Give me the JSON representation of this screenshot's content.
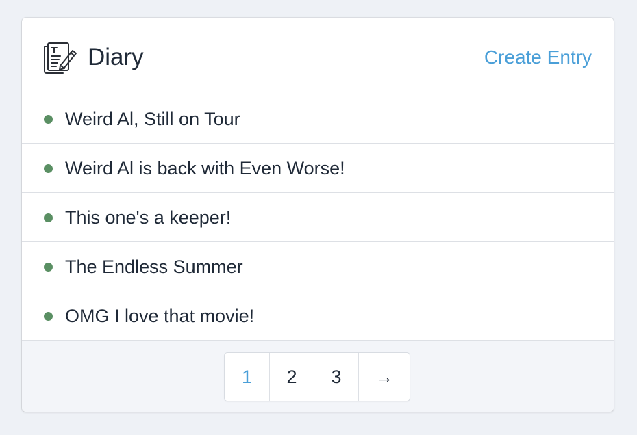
{
  "header": {
    "icon": "diary-edit-icon",
    "title": "Diary",
    "create_label": "Create Entry"
  },
  "entries": [
    {
      "title": "Weird Al, Still on Tour"
    },
    {
      "title": "Weird Al is back with Even Worse!"
    },
    {
      "title": "This one's a keeper!"
    },
    {
      "title": "The Endless Summer"
    },
    {
      "title": "OMG I love that movie!"
    }
  ],
  "pagination": {
    "pages": [
      "1",
      "2",
      "3"
    ],
    "current_page": "1",
    "next_symbol": "→",
    "next_icon": "arrow-right-icon"
  },
  "colors": {
    "accent": "#4a9fd8",
    "bullet": "#5a8f63",
    "text": "#1f2937",
    "background": "#eef1f6"
  }
}
